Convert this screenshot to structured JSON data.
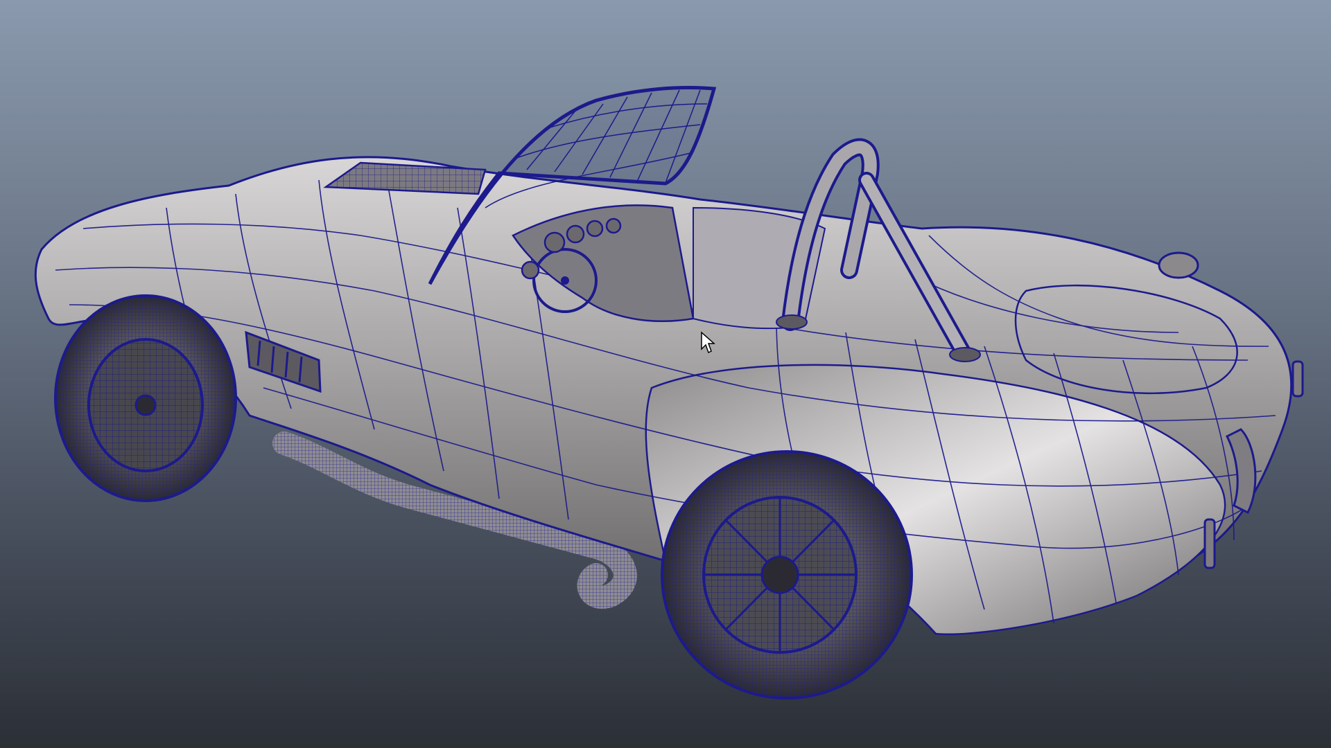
{
  "viewport": {
    "background_top": "#8a99ad",
    "background_bottom": "#2b2f36",
    "wire_color": "#1c1a8c",
    "surface_color": "#9a9898",
    "model": "roadster-wireframe-on-shaded",
    "cursor_icon": "arrow-cursor-icon"
  }
}
